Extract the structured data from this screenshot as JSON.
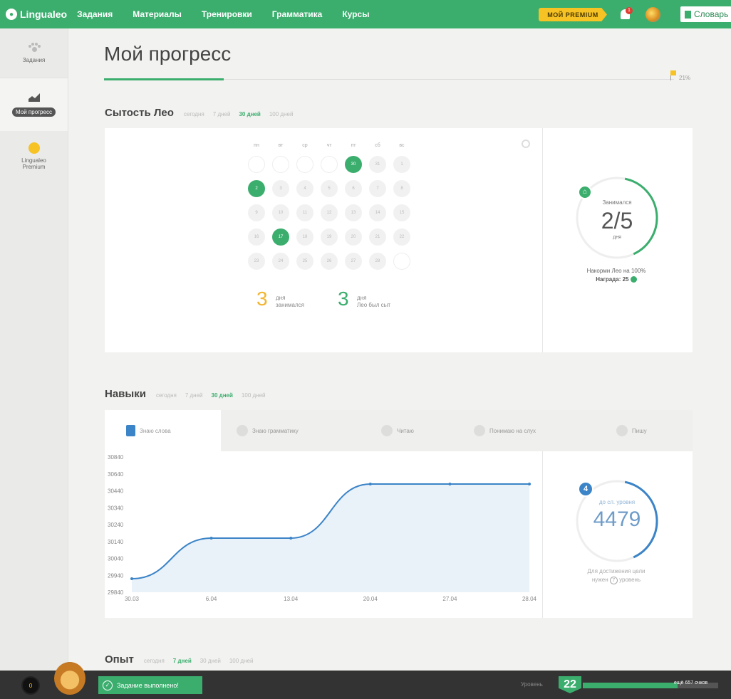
{
  "topbar": {
    "logo": "Lingualeo",
    "nav": [
      "Задания",
      "Материалы",
      "Тренировки",
      "Грамматика",
      "Курсы"
    ],
    "premium": "МОЙ PREMIUM",
    "bell_count": "1",
    "dictionary": "Словарь"
  },
  "sidebar": {
    "items": [
      {
        "label": "Задания"
      },
      {
        "label": "Мой прогресс"
      },
      {
        "label": "Lingualeo Premium"
      }
    ]
  },
  "page": {
    "title": "Мой прогресс",
    "goal_percent": "21%",
    "goal_fraction": 0.21
  },
  "satiety": {
    "title": "Сытость Лео",
    "periods": [
      "сегодня",
      "7 дней",
      "30 дней",
      "100 дней"
    ],
    "active_period": 2,
    "weekdays": [
      "пн",
      "вт",
      "ср",
      "чт",
      "пт",
      "сб",
      "вс"
    ],
    "weeks": [
      [
        "",
        "",
        "",
        "",
        "30",
        "31",
        "1"
      ],
      [
        "2",
        "3",
        "4",
        "5",
        "6",
        "7",
        "8"
      ],
      [
        "9",
        "10",
        "11",
        "12",
        "13",
        "14",
        "15"
      ],
      [
        "16",
        "17",
        "18",
        "19",
        "20",
        "21",
        "22"
      ],
      [
        "23",
        "24",
        "25",
        "26",
        "27",
        "28",
        ""
      ]
    ],
    "active_days": [
      "30",
      "2",
      "17"
    ],
    "stat1_num": "3",
    "stat1_label_a": "дня",
    "stat1_label_b": "занимался",
    "stat2_num": "3",
    "stat2_label_a": "дня",
    "stat2_label_b": "Лео был сыт",
    "ring_label": "Занимался",
    "ring_value": "2/5",
    "ring_unit": "дня",
    "ring_fraction": 0.4,
    "feed_text": "Накорми Лео на 100%",
    "reward_text": "Награда: 25"
  },
  "skills": {
    "title": "Навыки",
    "periods": [
      "сегодня",
      "7 дней",
      "30 дней",
      "100 дней"
    ],
    "active_period": 2,
    "tabs": [
      "Знаю слова",
      "Знаю грамматику",
      "Читаю",
      "Понимаю на слух",
      "Пишу"
    ],
    "level_badge": "4",
    "ring_label": "до сл. уровня",
    "ring_value": "4479",
    "goal_text_a": "Для достижения цели",
    "goal_text_b": "нужен",
    "goal_level": "7",
    "goal_text_c": "уровень",
    "ring_fraction": 0.4
  },
  "chart_data": {
    "type": "area",
    "x": [
      "30.03",
      "6.04",
      "13.04",
      "20.04",
      "27.04",
      "28.04"
    ],
    "values": [
      29940,
      30240,
      30240,
      30640,
      30640,
      30640
    ],
    "y_ticks": [
      "30840",
      "30640",
      "30440",
      "30340",
      "30240",
      "30140",
      "30040",
      "29940",
      "29840"
    ],
    "ylim": [
      29840,
      30840
    ],
    "color": "#3b84c7",
    "fill": "#e9f1f9"
  },
  "experience": {
    "title": "Опыт",
    "periods": [
      "сегодня",
      "7 дней",
      "30 дней",
      "100 дней"
    ],
    "active_period": 1
  },
  "bottombar": {
    "coins": "0",
    "toast": "Задание выполнено!",
    "level_label": "Уровень",
    "level": "22",
    "xp_text": "ещё 657 очков",
    "xp_fraction": 0.7
  }
}
